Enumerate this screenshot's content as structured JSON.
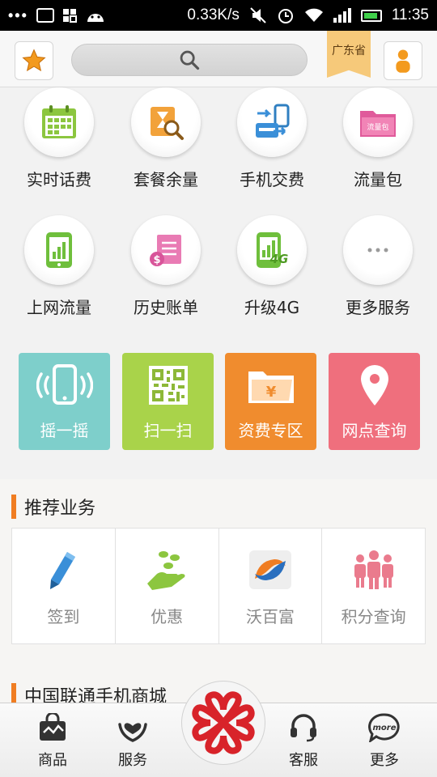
{
  "status_bar": {
    "speed": "0.33K/s",
    "time": "11:35",
    "dots": "•••"
  },
  "header": {
    "province": "广东省",
    "favorites_icon": "star-icon",
    "search_icon": "search-icon",
    "user_icon": "person-icon"
  },
  "services": [
    {
      "label": "实时话费",
      "icon": "calendar-icon"
    },
    {
      "label": "套餐余量",
      "icon": "hourglass-search-icon"
    },
    {
      "label": "手机交费",
      "icon": "transfer-card-icon"
    },
    {
      "label": "流量包",
      "icon": "folder-icon",
      "badge": "流量包"
    },
    {
      "label": "上网流量",
      "icon": "phone-chart-icon"
    },
    {
      "label": "历史账单",
      "icon": "bill-icon"
    },
    {
      "label": "升级4G",
      "icon": "4g-icon",
      "badge": "4G"
    },
    {
      "label": "更多服务",
      "icon": "more-icon"
    }
  ],
  "tiles": [
    {
      "label": "摇一摇",
      "icon": "shake-phone-icon",
      "color": "#7ecfcb"
    },
    {
      "label": "扫一扫",
      "icon": "qr-code-icon",
      "color": "#a9d34a"
    },
    {
      "label": "资费专区",
      "icon": "yen-folder-icon",
      "color": "#f08c2e",
      "yen": "¥"
    },
    {
      "label": "网点查询",
      "icon": "location-pin-icon",
      "color": "#ef6f7d"
    }
  ],
  "recommended": {
    "title": "推荐业务",
    "items": [
      {
        "label": "签到",
        "icon": "pencil-icon"
      },
      {
        "label": "优惠",
        "icon": "coins-hand-icon"
      },
      {
        "label": "沃百富",
        "icon": "wobaifu-logo-icon"
      },
      {
        "label": "积分查询",
        "icon": "people-icon"
      }
    ]
  },
  "mall": {
    "title": "中国联通手机商城"
  },
  "bottom_nav": [
    {
      "label": "商品",
      "icon": "shopping-bag-icon"
    },
    {
      "label": "服务",
      "icon": "heart-hands-icon"
    },
    {
      "label": "客服",
      "icon": "headset-icon"
    },
    {
      "label": "更多",
      "icon": "more-bubble-icon",
      "badge": "more"
    }
  ],
  "colors": {
    "accent_orange": "#f07d22",
    "unicom_red": "#d8232a"
  }
}
